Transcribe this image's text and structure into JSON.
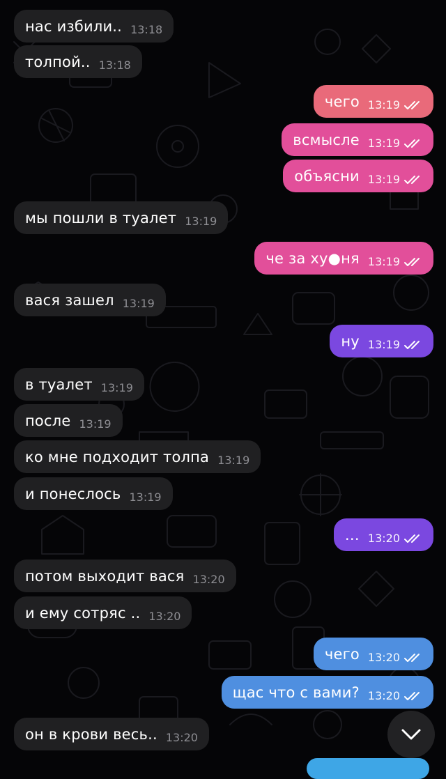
{
  "colors": {
    "background": "#050507",
    "incoming_bubble": "#202022",
    "incoming_time": "#8e8e93",
    "outgoing_pink": "#e24f9a",
    "outgoing_coral": "#e96a7a",
    "outgoing_purple": "#7b48e0",
    "outgoing_blue": "#4f8fe0"
  },
  "chat": {
    "messages": [
      {
        "text": "нас избили..",
        "time": "13:18",
        "dir": "in"
      },
      {
        "text": "толпой..",
        "time": "13:18",
        "dir": "in"
      },
      {
        "text": "чего",
        "time": "13:19",
        "dir": "out"
      },
      {
        "text": "всмысле",
        "time": "13:19",
        "dir": "out"
      },
      {
        "text": "объясни",
        "time": "13:19",
        "dir": "out"
      },
      {
        "text": "мы пошли в туалет",
        "time": "13:19",
        "dir": "in"
      },
      {
        "text": "че за ху●ня",
        "time": "13:19",
        "dir": "out"
      },
      {
        "text": "вася зашел",
        "time": "13:19",
        "dir": "in"
      },
      {
        "text": "ну",
        "time": "13:19",
        "dir": "out"
      },
      {
        "text": "в туалет",
        "time": "13:19",
        "dir": "in"
      },
      {
        "text": "после",
        "time": "13:19",
        "dir": "in"
      },
      {
        "text": "ко мне подходит толпа",
        "time": "13:19",
        "dir": "in"
      },
      {
        "text": "и понеслось",
        "time": "13:19",
        "dir": "in"
      },
      {
        "text": "…",
        "time": "13:20",
        "dir": "out"
      },
      {
        "text": "потом выходит вася",
        "time": "13:20",
        "dir": "in"
      },
      {
        "text": "и ему сотряс  ..",
        "time": "13:20",
        "dir": "in"
      },
      {
        "text": "чего",
        "time": "13:20",
        "dir": "out"
      },
      {
        "text": "щас что с вами?",
        "time": "13:20",
        "dir": "out"
      },
      {
        "text": "он в крови весь..",
        "time": "13:20",
        "dir": "in"
      }
    ],
    "read_status_icon": "double-check-icon",
    "scroll_button_icon": "chevron-down-icon"
  }
}
